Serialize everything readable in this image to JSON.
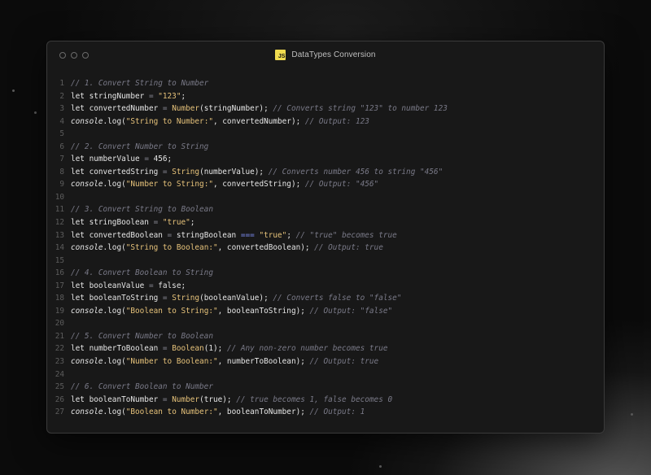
{
  "window": {
    "title": "DataTypes Conversion",
    "badge": "JS"
  },
  "colors": {
    "background": "#0b0b0b",
    "editor": "#181818",
    "string": "#e6c27a",
    "comment": "#7a7a88",
    "strict_equality": "#7c8cf0",
    "line_number": "#5c5c5c",
    "badge": "#f0db4f"
  },
  "code": {
    "lines": [
      {
        "n": "1",
        "tokens": [
          [
            "comment",
            "// 1. Convert String to Number"
          ]
        ]
      },
      {
        "n": "2",
        "tokens": [
          [
            "keyword",
            "let "
          ],
          [
            "ident",
            "stringNumber "
          ],
          [
            "op",
            "= "
          ],
          [
            "string",
            "\"123\""
          ],
          [
            "punc",
            ";"
          ]
        ]
      },
      {
        "n": "3",
        "tokens": [
          [
            "keyword",
            "let "
          ],
          [
            "ident",
            "convertedNumber "
          ],
          [
            "op",
            "= "
          ],
          [
            "func",
            "Number"
          ],
          [
            "punc",
            "(stringNumber); "
          ],
          [
            "comment",
            "// Converts string \"123\" to number 123"
          ]
        ]
      },
      {
        "n": "4",
        "tokens": [
          [
            "console",
            "console"
          ],
          [
            "punc",
            ".log("
          ],
          [
            "string",
            "\"String to Number:\""
          ],
          [
            "punc",
            ", convertedNumber); "
          ],
          [
            "comment",
            "// Output: 123"
          ]
        ]
      },
      {
        "n": "5",
        "tokens": []
      },
      {
        "n": "6",
        "tokens": [
          [
            "comment",
            "// 2. Convert Number to String"
          ]
        ]
      },
      {
        "n": "7",
        "tokens": [
          [
            "keyword",
            "let "
          ],
          [
            "ident",
            "numberValue "
          ],
          [
            "op",
            "= "
          ],
          [
            "number",
            "456"
          ],
          [
            "punc",
            ";"
          ]
        ]
      },
      {
        "n": "8",
        "tokens": [
          [
            "keyword",
            "let "
          ],
          [
            "ident",
            "convertedString "
          ],
          [
            "op",
            "= "
          ],
          [
            "func",
            "String"
          ],
          [
            "punc",
            "(numberValue); "
          ],
          [
            "comment",
            "// Converts number 456 to string \"456\""
          ]
        ]
      },
      {
        "n": "9",
        "tokens": [
          [
            "console",
            "console"
          ],
          [
            "punc",
            ".log("
          ],
          [
            "string",
            "\"Number to String:\""
          ],
          [
            "punc",
            ", convertedString); "
          ],
          [
            "comment",
            "// Output: \"456\""
          ]
        ]
      },
      {
        "n": "10",
        "tokens": []
      },
      {
        "n": "11",
        "tokens": [
          [
            "comment",
            "// 3. Convert String to Boolean"
          ]
        ]
      },
      {
        "n": "12",
        "tokens": [
          [
            "keyword",
            "let "
          ],
          [
            "ident",
            "stringBoolean "
          ],
          [
            "op",
            "= "
          ],
          [
            "string",
            "\"true\""
          ],
          [
            "punc",
            ";"
          ]
        ]
      },
      {
        "n": "13",
        "tokens": [
          [
            "keyword",
            "let "
          ],
          [
            "ident",
            "convertedBoolean "
          ],
          [
            "op",
            "= "
          ],
          [
            "ident",
            "stringBoolean "
          ],
          [
            "eqeq",
            "==="
          ],
          [
            "punc",
            " "
          ],
          [
            "string",
            "\"true\""
          ],
          [
            "punc",
            "; "
          ],
          [
            "comment",
            "// \"true\" becomes true"
          ]
        ]
      },
      {
        "n": "14",
        "tokens": [
          [
            "console",
            "console"
          ],
          [
            "punc",
            ".log("
          ],
          [
            "string",
            "\"String to Boolean:\""
          ],
          [
            "punc",
            ", convertedBoolean); "
          ],
          [
            "comment",
            "// Output: true"
          ]
        ]
      },
      {
        "n": "15",
        "tokens": []
      },
      {
        "n": "16",
        "tokens": [
          [
            "comment",
            "// 4. Convert Boolean to String"
          ]
        ]
      },
      {
        "n": "17",
        "tokens": [
          [
            "keyword",
            "let "
          ],
          [
            "ident",
            "booleanValue "
          ],
          [
            "op",
            "= "
          ],
          [
            "bool",
            "false"
          ],
          [
            "punc",
            ";"
          ]
        ]
      },
      {
        "n": "18",
        "tokens": [
          [
            "keyword",
            "let "
          ],
          [
            "ident",
            "booleanToString "
          ],
          [
            "op",
            "= "
          ],
          [
            "func",
            "String"
          ],
          [
            "punc",
            "(booleanValue); "
          ],
          [
            "comment",
            "// Converts false to \"false\""
          ]
        ]
      },
      {
        "n": "19",
        "tokens": [
          [
            "console",
            "console"
          ],
          [
            "punc",
            ".log("
          ],
          [
            "string",
            "\"Boolean to String:\""
          ],
          [
            "punc",
            ", booleanToString); "
          ],
          [
            "comment",
            "// Output: \"false\""
          ]
        ]
      },
      {
        "n": "20",
        "tokens": []
      },
      {
        "n": "21",
        "tokens": [
          [
            "comment",
            "// 5. Convert Number to Boolean"
          ]
        ]
      },
      {
        "n": "22",
        "tokens": [
          [
            "keyword",
            "let "
          ],
          [
            "ident",
            "numberToBoolean "
          ],
          [
            "op",
            "= "
          ],
          [
            "func",
            "Boolean"
          ],
          [
            "punc",
            "(1); "
          ],
          [
            "comment",
            "// Any non-zero number becomes true"
          ]
        ]
      },
      {
        "n": "23",
        "tokens": [
          [
            "console",
            "console"
          ],
          [
            "punc",
            ".log("
          ],
          [
            "string",
            "\"Number to Boolean:\""
          ],
          [
            "punc",
            ", numberToBoolean); "
          ],
          [
            "comment",
            "// Output: true"
          ]
        ]
      },
      {
        "n": "24",
        "tokens": []
      },
      {
        "n": "25",
        "tokens": [
          [
            "comment",
            "// 6. Convert Boolean to Number"
          ]
        ]
      },
      {
        "n": "26",
        "tokens": [
          [
            "keyword",
            "let "
          ],
          [
            "ident",
            "booleanToNumber "
          ],
          [
            "op",
            "= "
          ],
          [
            "func",
            "Number"
          ],
          [
            "punc",
            "(true); "
          ],
          [
            "comment",
            "// true becomes 1, false becomes 0"
          ]
        ]
      },
      {
        "n": "27",
        "tokens": [
          [
            "console",
            "console"
          ],
          [
            "punc",
            ".log("
          ],
          [
            "string",
            "\"Boolean to Number:\""
          ],
          [
            "punc",
            ", booleanToNumber); "
          ],
          [
            "comment",
            "// Output: 1"
          ]
        ]
      }
    ]
  }
}
